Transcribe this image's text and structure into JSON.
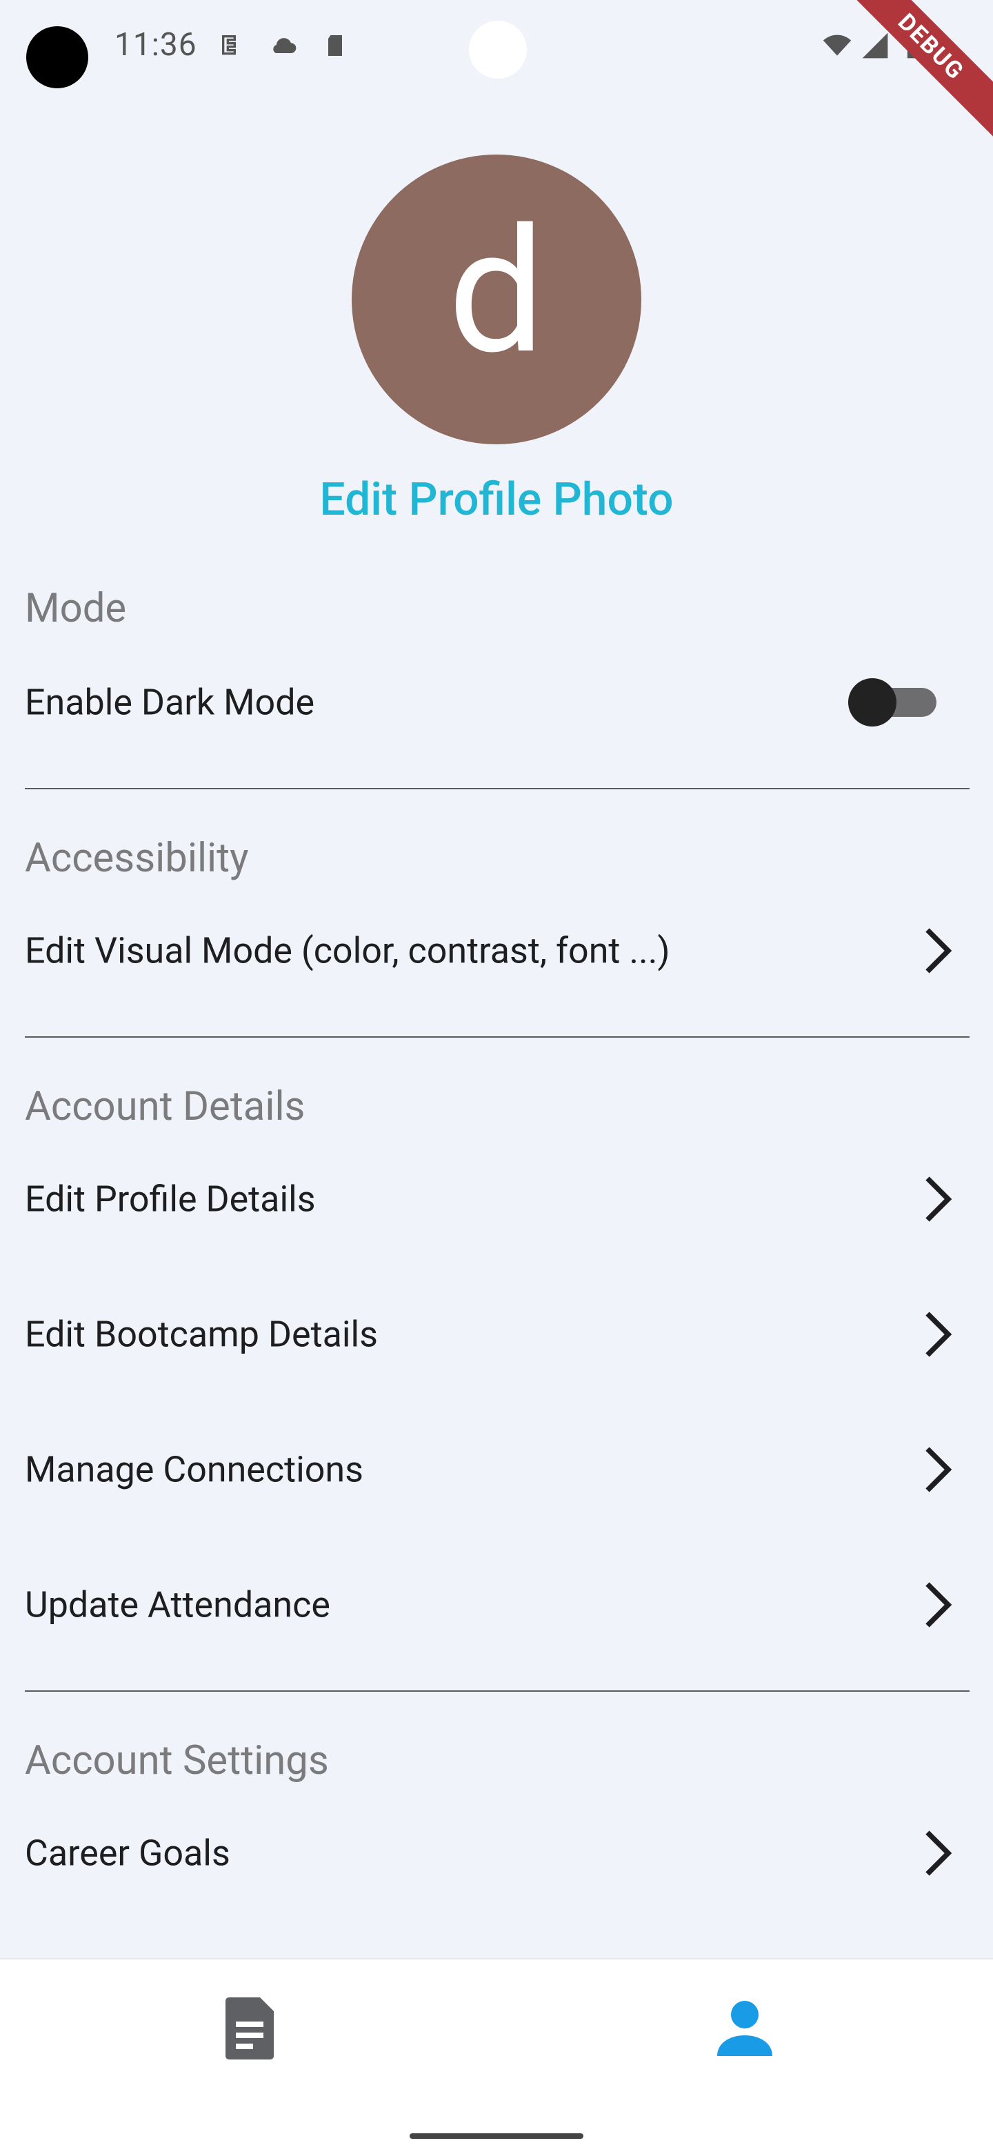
{
  "status_bar": {
    "time": "11:36",
    "debug_label": "DEBUG"
  },
  "profile": {
    "avatar_initial": "d",
    "avatar_color": "#8d6b60",
    "edit_photo_label": "Edit Profile Photo"
  },
  "accent_color": "#21b6d3",
  "sections": {
    "mode": {
      "header": "Mode",
      "dark_mode_label": "Enable Dark Mode",
      "dark_mode_enabled": false
    },
    "accessibility": {
      "header": "Accessibility",
      "visual_mode_label": "Edit Visual Mode (color, contrast, font ...)"
    },
    "account_details": {
      "header": "Account Details",
      "items": [
        "Edit Profile Details",
        "Edit Bootcamp Details",
        "Manage Connections",
        "Update Attendance"
      ]
    },
    "account_settings": {
      "header": "Account Settings",
      "items": [
        "Career Goals"
      ]
    }
  },
  "bottom_nav": {
    "items": [
      {
        "icon": "document-icon",
        "active": false
      },
      {
        "icon": "person-icon",
        "active": true
      }
    ],
    "active_color": "#1a9be6"
  }
}
